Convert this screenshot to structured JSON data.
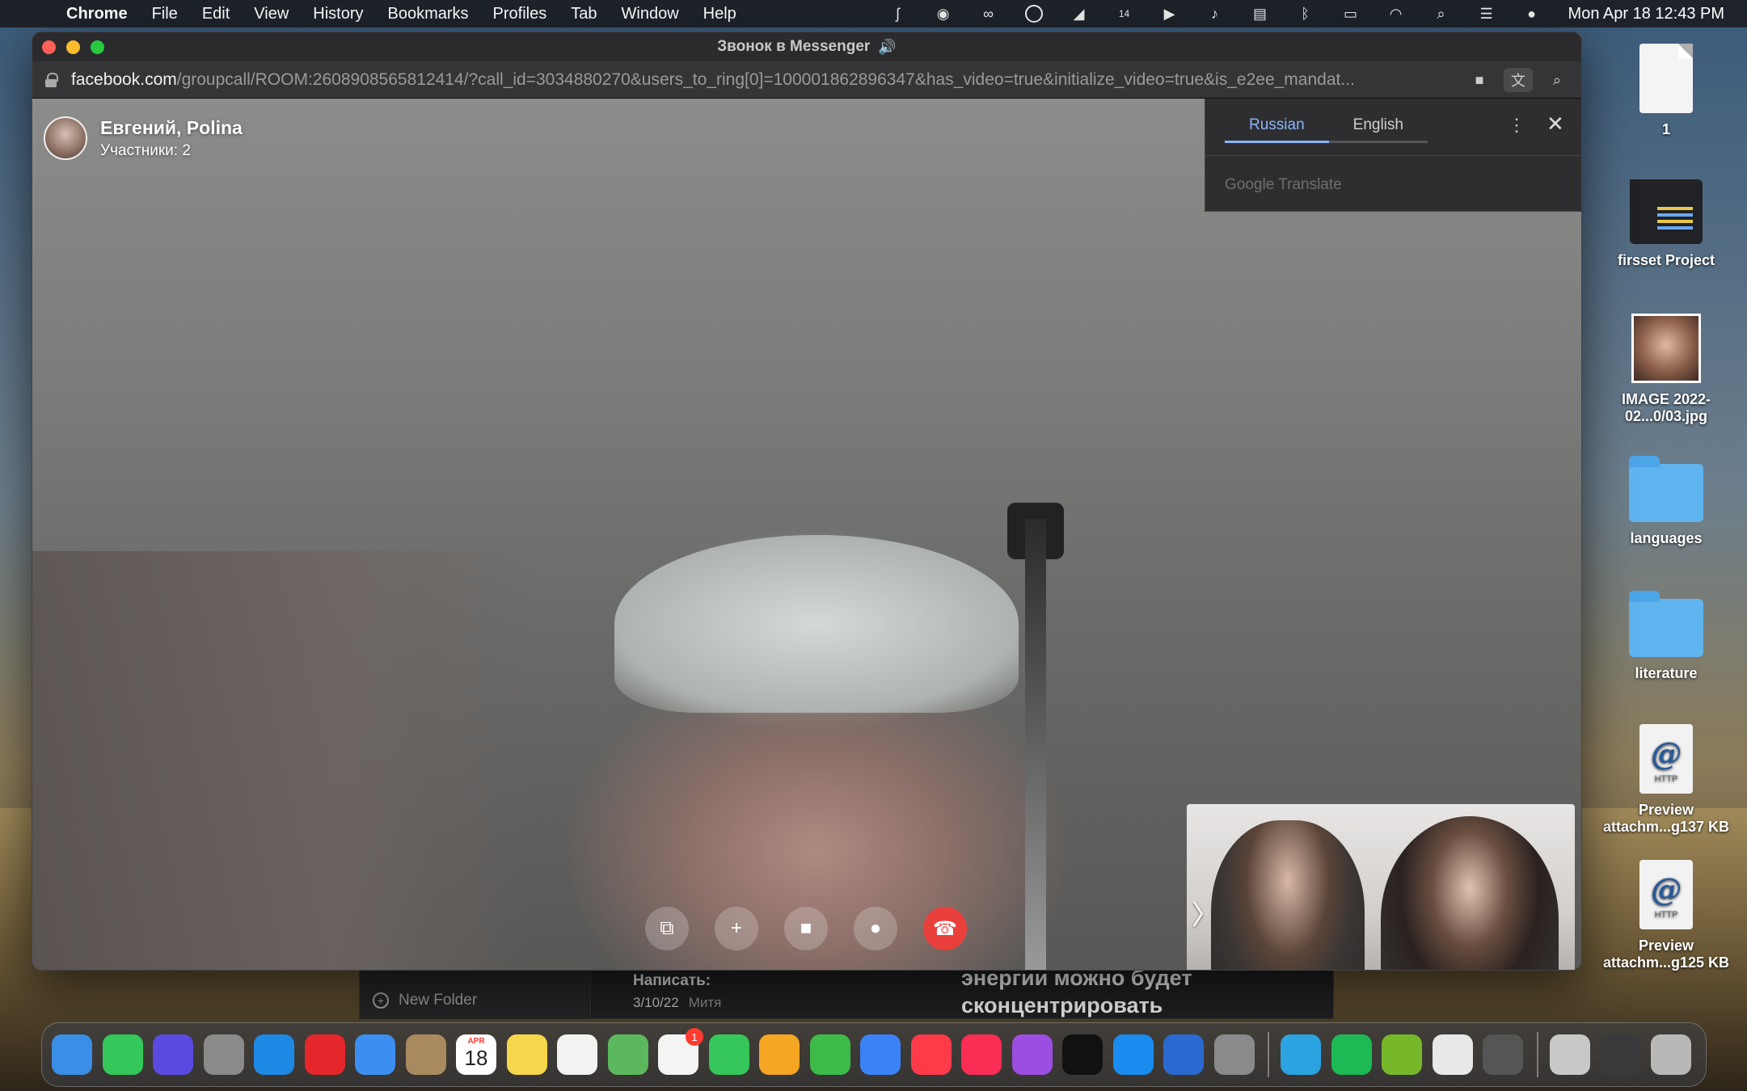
{
  "menubar": {
    "app_name": "Chrome",
    "items": [
      "File",
      "Edit",
      "View",
      "History",
      "Bookmarks",
      "Profiles",
      "Tab",
      "Window",
      "Help"
    ],
    "status_icons": [
      "scribe-icon",
      "recorder-icon",
      "creative-cloud-icon",
      "utorrent-icon",
      "swiftly-icon",
      "notification-count-icon",
      "play-icon",
      "volume-icon",
      "us-flag-icon",
      "bluetooth-icon",
      "battery-icon",
      "wifi-icon",
      "spotlight-icon",
      "control-center-icon",
      "siri-icon"
    ],
    "notification_count": "14",
    "clock": "Mon Apr 18  12:43 PM"
  },
  "window": {
    "title": "Звонок в Messenger",
    "url_domain": "facebook.com",
    "url_path": "/groupcall/ROOM:2608908565812414/?call_id=3034880270&users_to_ring[0]=100001862896347&has_video=true&initialize_video=true&is_e2ee_mandat..."
  },
  "call": {
    "names": "Евгений, Polina",
    "participants": "Участники: 2",
    "controls": [
      "share-screen-icon",
      "add-person-icon",
      "video-camera-icon",
      "microphone-icon",
      "end-call-icon"
    ]
  },
  "translate": {
    "tabs": [
      "Russian",
      "English"
    ],
    "active_tab": "Russian",
    "brand": "Google Translate"
  },
  "notes_window": {
    "new_folder": "New Folder",
    "note_title": "Написать:",
    "note_date": "3/10/22",
    "note_author": "Митя",
    "body_line1": "энергии можно будет",
    "body_line2": "сконцентрировать"
  },
  "desktop": {
    "items": [
      {
        "label": "1",
        "kind": "document"
      },
      {
        "label": "firsset Project",
        "kind": "code-folder"
      },
      {
        "label": "IMAGE 2022-02...0/03.jpg",
        "kind": "image"
      },
      {
        "label": "languages",
        "kind": "folder"
      },
      {
        "label": "literature",
        "kind": "folder"
      },
      {
        "label": "Preview attachm...g137 KB",
        "kind": "http"
      },
      {
        "label": "Preview attachm...g125 KB",
        "kind": "http"
      }
    ]
  },
  "dock": {
    "apps": [
      {
        "name": "finder",
        "color": "#3a8ee6"
      },
      {
        "name": "facetime",
        "color": "#34c759"
      },
      {
        "name": "siri",
        "color": "#5a4ae0"
      },
      {
        "name": "launchpad",
        "color": "#8a8a8a"
      },
      {
        "name": "safari",
        "color": "#1e88e5"
      },
      {
        "name": "opera",
        "color": "#e5262a"
      },
      {
        "name": "mail",
        "color": "#3c8ef0"
      },
      {
        "name": "contacts",
        "color": "#a88a5e"
      },
      {
        "name": "calendar",
        "color": "#ffffff"
      },
      {
        "name": "notes",
        "color": "#f6d64a"
      },
      {
        "name": "reminders",
        "color": "#f2f2f2"
      },
      {
        "name": "maps",
        "color": "#5cb85c"
      },
      {
        "name": "photos",
        "color": "#f4f4f4"
      },
      {
        "name": "messages",
        "color": "#35c759"
      },
      {
        "name": "pages",
        "color": "#f5a623"
      },
      {
        "name": "numbers",
        "color": "#3dbb4a"
      },
      {
        "name": "keynote",
        "color": "#3b82f6"
      },
      {
        "name": "news",
        "color": "#ff3b4a"
      },
      {
        "name": "music",
        "color": "#fa2d55"
      },
      {
        "name": "podcasts",
        "color": "#9b4ee0"
      },
      {
        "name": "apple-tv",
        "color": "#111111"
      },
      {
        "name": "app-store",
        "color": "#1a8cf0"
      },
      {
        "name": "swiftly",
        "color": "#2a6ad0"
      },
      {
        "name": "system-preferences",
        "color": "#8a8a8c"
      },
      {
        "name": "telegram",
        "color": "#2aa3e0"
      },
      {
        "name": "spotify",
        "color": "#1db954"
      },
      {
        "name": "utorrent",
        "color": "#76b82a"
      },
      {
        "name": "chrome",
        "color": "#e8e8e8"
      },
      {
        "name": "scribe",
        "color": "#555555"
      },
      {
        "name": "documents-stack",
        "color": "#c8c8c8"
      },
      {
        "name": "screenshots-stack",
        "color": "#3a3a3c"
      },
      {
        "name": "trash",
        "color": "#b8b8b8"
      }
    ],
    "calendar_month": "APR",
    "calendar_day": "18",
    "photos_badge": "1"
  }
}
